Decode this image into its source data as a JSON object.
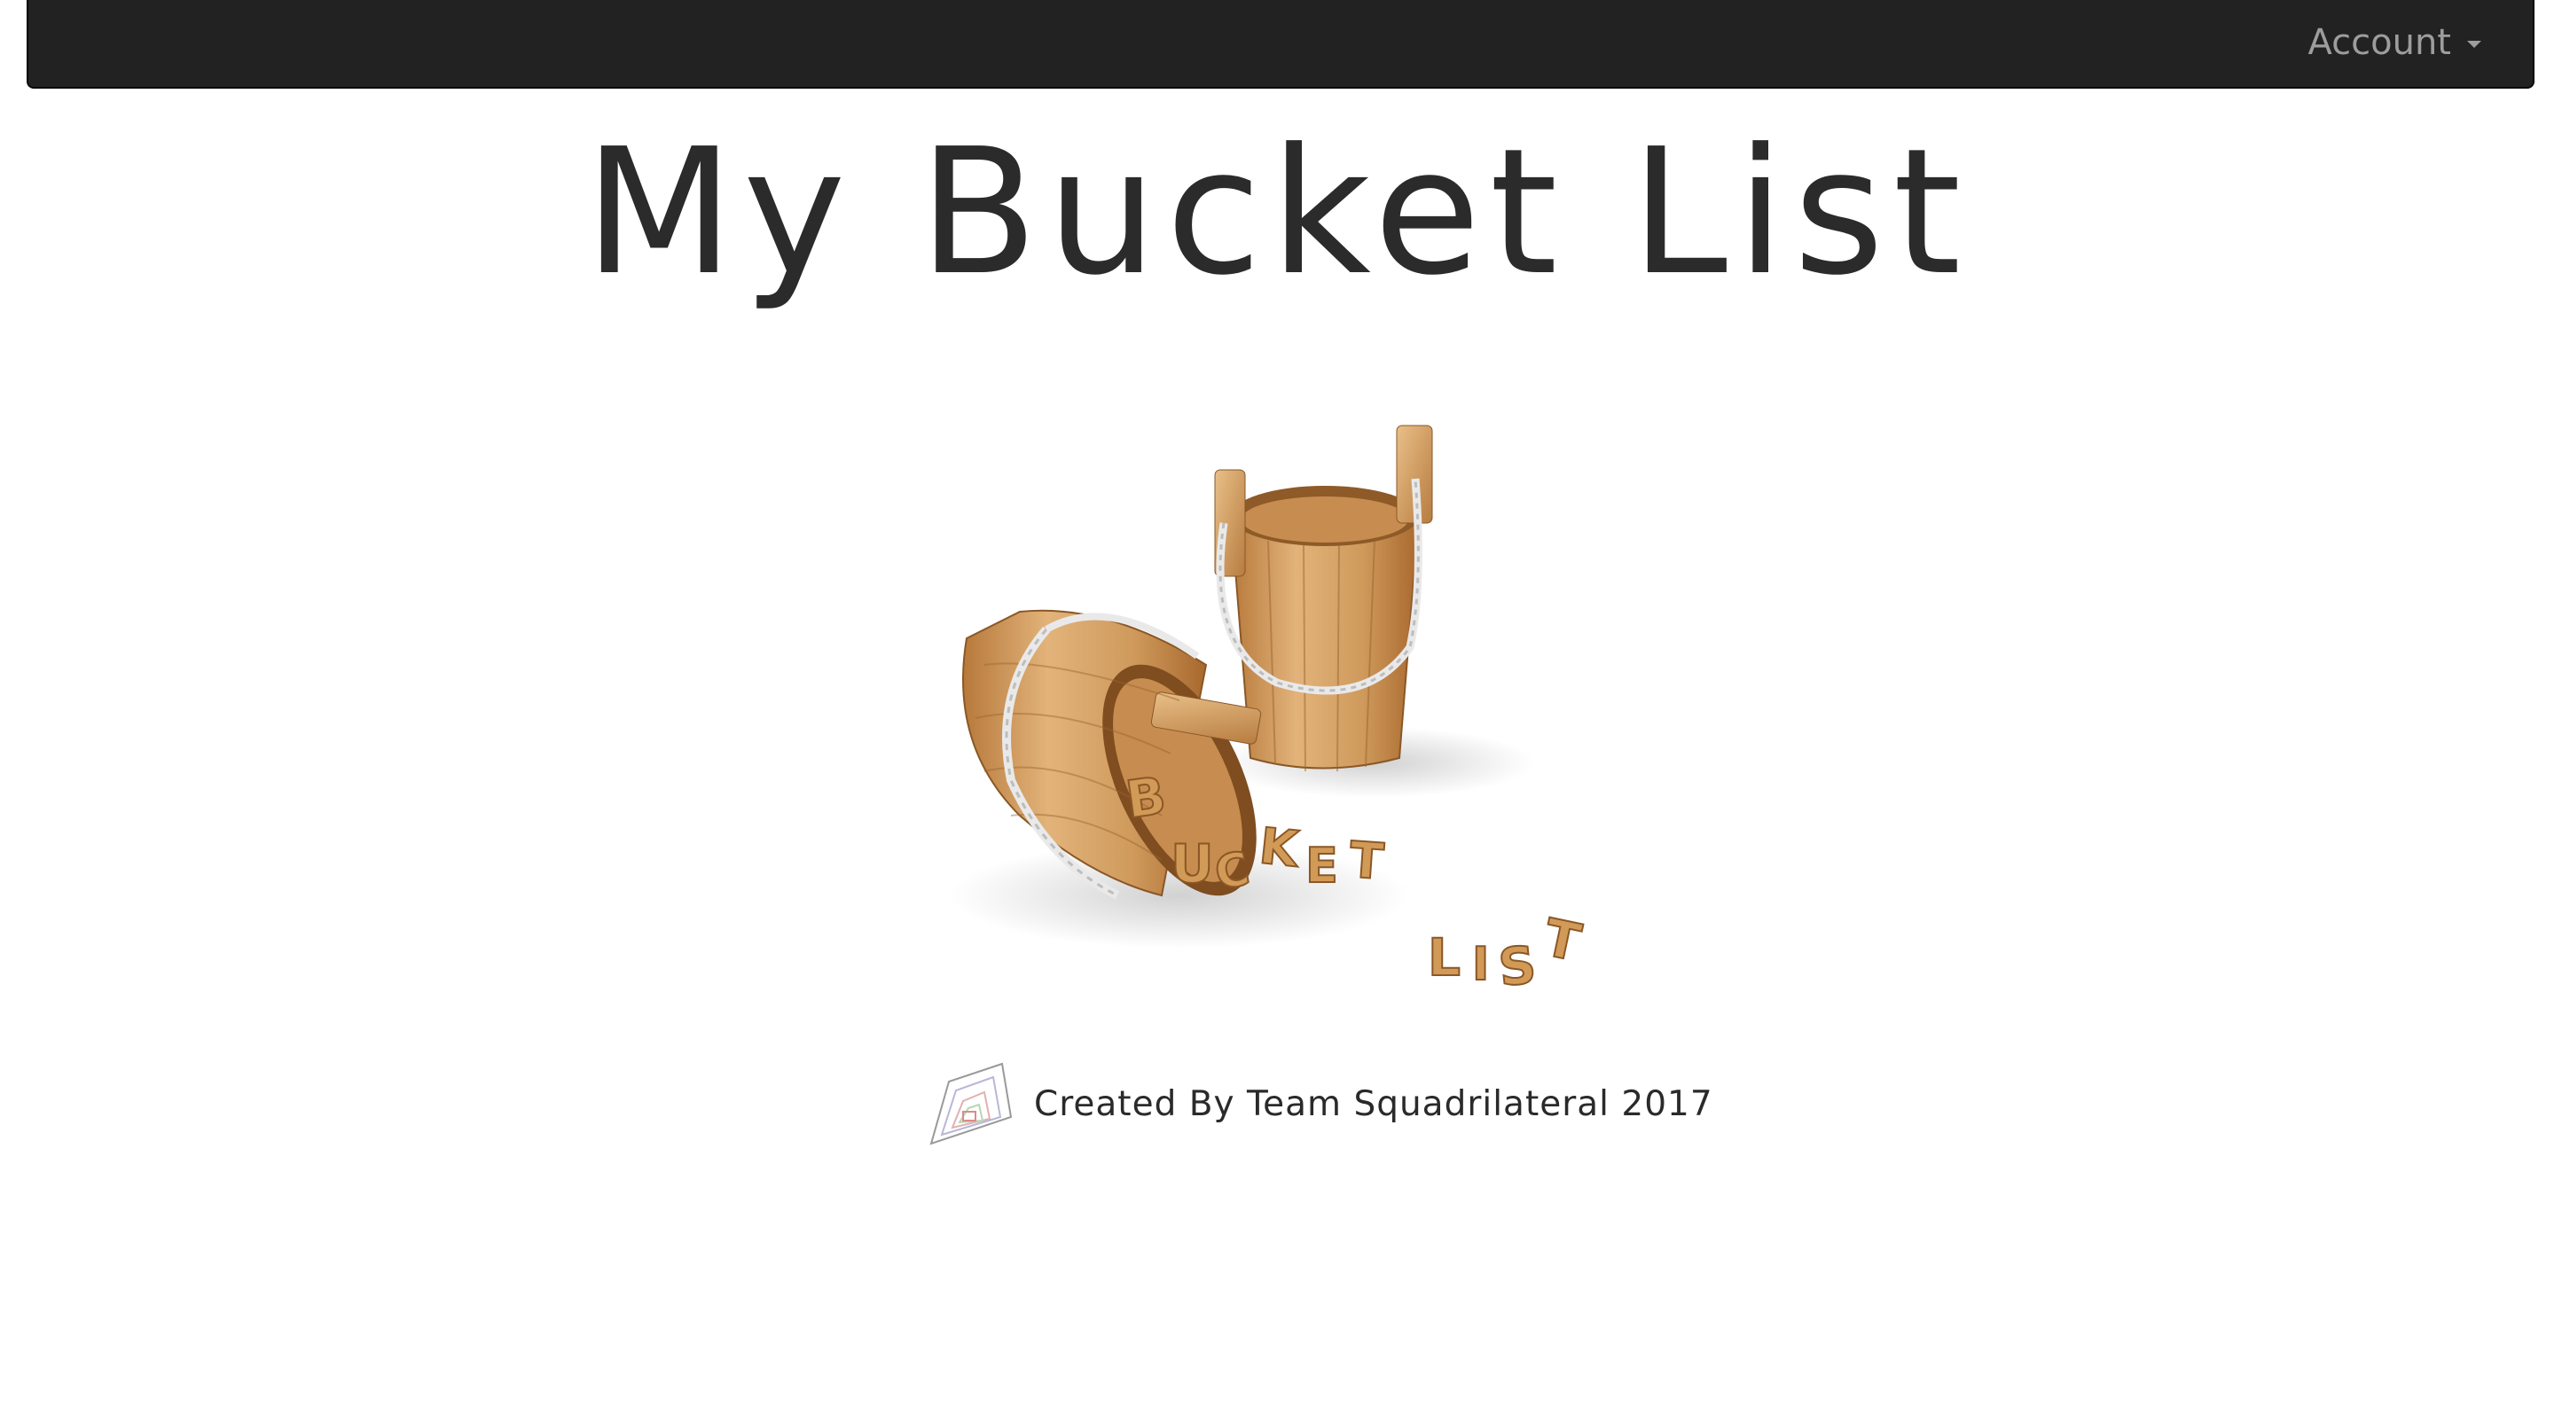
{
  "navbar": {
    "account_label": "Account"
  },
  "header": {
    "title": "My Bucket List"
  },
  "hero": {
    "letters_row1": "BUCKET",
    "letters_row2": "LIST"
  },
  "footer": {
    "credit_text": "Created By Team Squadrilateral 2017"
  },
  "colors": {
    "navbar_bg": "#222222",
    "nav_text": "#9d9d9d",
    "title_text": "#2b2b2b",
    "wood": "#c98e4f"
  }
}
